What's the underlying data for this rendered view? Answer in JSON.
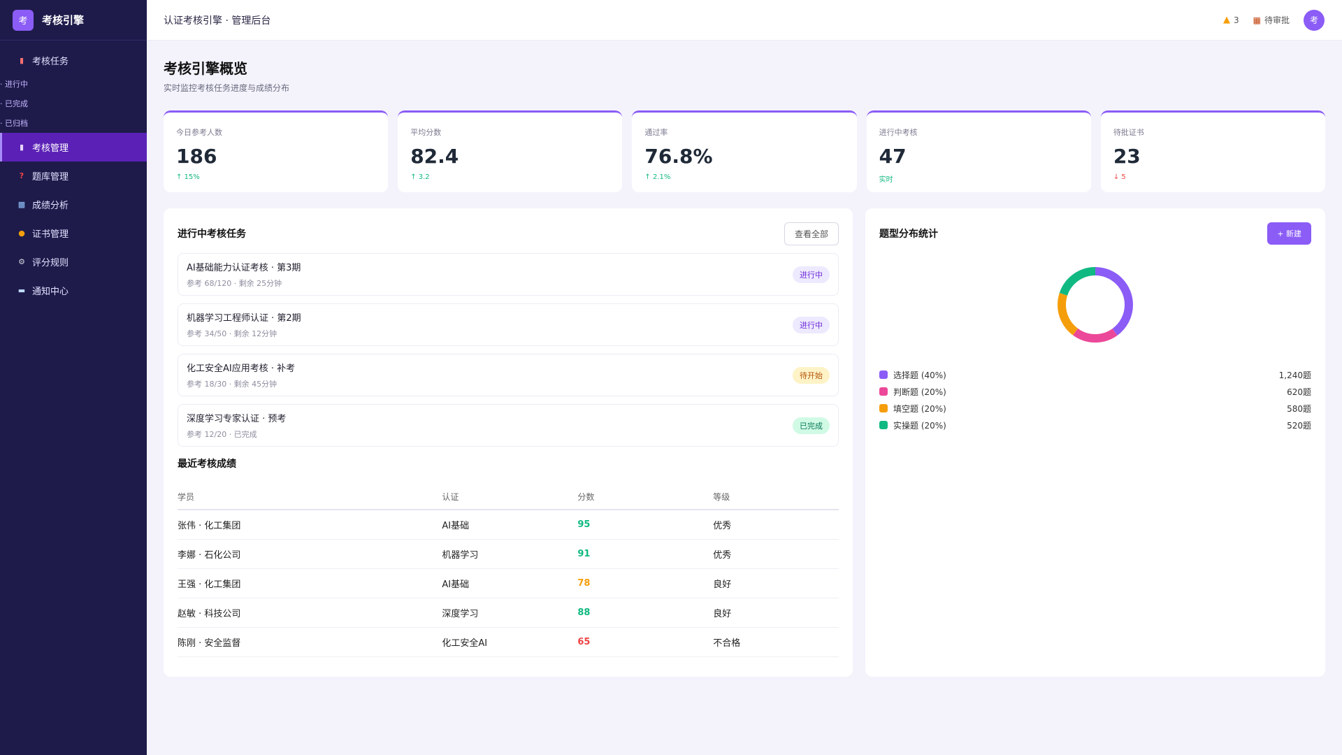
{
  "brand": {
    "logo": "考",
    "name": "考核引擎"
  },
  "sidebar": {
    "top_item": {
      "label": "考核任务",
      "icon": "document-icon"
    },
    "sub_items": [
      "· 进行中",
      "· 已完成",
      "· 已归档"
    ],
    "items": [
      {
        "label": "考核管理",
        "icon": "clipboard-icon",
        "active": true
      },
      {
        "label": "题库管理",
        "icon": "question-icon",
        "active": false
      },
      {
        "label": "成绩分析",
        "icon": "chart-icon",
        "active": false
      },
      {
        "label": "证书管理",
        "icon": "medal-icon",
        "active": false
      },
      {
        "label": "评分规则",
        "icon": "gear-icon",
        "active": false
      },
      {
        "label": "通知中心",
        "icon": "inbox-icon",
        "active": false
      }
    ]
  },
  "topbar": {
    "title": "认证考核引擎 · 管理后台",
    "bell_count": "3",
    "pending_label": "待审批",
    "avatar": "考"
  },
  "page": {
    "title": "考核引擎概览",
    "subtitle": "实时监控考核任务进度与成绩分布"
  },
  "stats": [
    {
      "label": "今日参考人数",
      "value": "186",
      "delta": "↑ 15%",
      "trend": "up"
    },
    {
      "label": "平均分数",
      "value": "82.4",
      "delta": "↑ 3.2",
      "trend": "up"
    },
    {
      "label": "通过率",
      "value": "76.8%",
      "delta": "↑ 2.1%",
      "trend": "up"
    },
    {
      "label": "进行中考核",
      "value": "47",
      "delta": "实时",
      "trend": "up"
    },
    {
      "label": "待批证书",
      "value": "23",
      "delta": "↓ 5",
      "trend": "down"
    }
  ],
  "tasks_panel": {
    "title": "进行中考核任务",
    "view_all": "查看全部",
    "tasks": [
      {
        "name": "AI基础能力认证考核 · 第3期",
        "meta": "参考 68/120 · 剩余 25分钟",
        "status": "进行中",
        "status_type": "purple"
      },
      {
        "name": "机器学习工程师认证 · 第2期",
        "meta": "参考 34/50 · 剩余 12分钟",
        "status": "进行中",
        "status_type": "purple"
      },
      {
        "name": "化工安全AI应用考核 · 补考",
        "meta": "参考 18/30 · 剩余 45分钟",
        "status": "待开始",
        "status_type": "yellow"
      },
      {
        "name": "深度学习专家认证 · 预考",
        "meta": "参考 12/20 · 已完成",
        "status": "已完成",
        "status_type": "green"
      }
    ]
  },
  "results": {
    "title": "最近考核成绩",
    "headers": [
      "学员",
      "认证",
      "分数",
      "等级"
    ],
    "rows": [
      {
        "student": "张伟 · 化工集团",
        "cert": "AI基础",
        "score": "95",
        "grade": "优秀",
        "color": "green"
      },
      {
        "student": "李娜 · 石化公司",
        "cert": "机器学习",
        "score": "91",
        "grade": "优秀",
        "color": "green"
      },
      {
        "student": "王强 · 化工集团",
        "cert": "AI基础",
        "score": "78",
        "grade": "良好",
        "color": "orange"
      },
      {
        "student": "赵敏 · 科技公司",
        "cert": "深度学习",
        "score": "88",
        "grade": "良好",
        "color": "green"
      },
      {
        "student": "陈刚 · 安全监督",
        "cert": "化工安全AI",
        "score": "65",
        "grade": "不合格",
        "color": "red"
      }
    ]
  },
  "distribution": {
    "title": "题型分布统计",
    "new_button": "+ 新建",
    "items": [
      {
        "label": "选择题 (40%)",
        "count": "1,240题",
        "percent": 40,
        "color": "#8b5cf6"
      },
      {
        "label": "判断题 (20%)",
        "count": "620题",
        "percent": 20,
        "color": "#ec4899"
      },
      {
        "label": "填空题 (20%)",
        "count": "580题",
        "percent": 20,
        "color": "#f59e0b"
      },
      {
        "label": "实操题 (20%)",
        "count": "520题",
        "percent": 20,
        "color": "#10b981"
      }
    ]
  }
}
